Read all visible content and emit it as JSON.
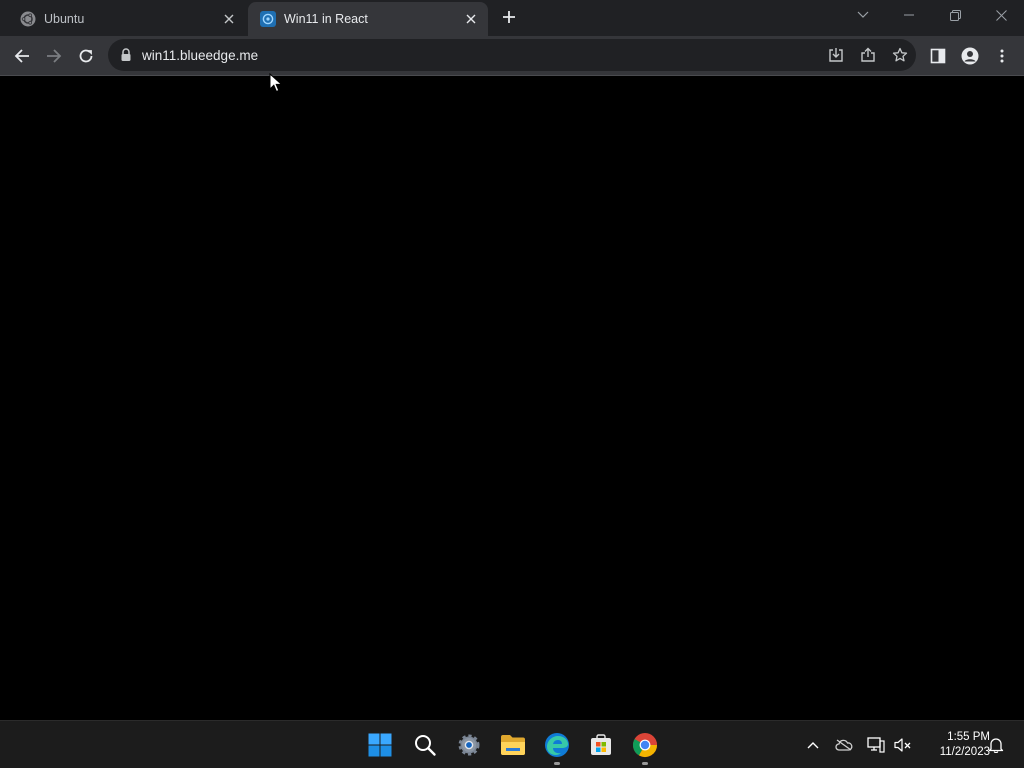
{
  "browser": {
    "tabs": [
      {
        "title": "Ubuntu",
        "active": false,
        "favicon": "ubuntu-logo-icon"
      },
      {
        "title": "Win11 in React",
        "active": true,
        "favicon": "win11-react-favicon-icon"
      }
    ],
    "address": "win11.blueedge.me",
    "colors": {
      "frame": "#202124",
      "toolbar": "#35363a",
      "omnibox": "#202124",
      "text": "#e8eaed"
    }
  },
  "taskbar": {
    "apps": [
      {
        "name": "start-icon"
      },
      {
        "name": "search-icon"
      },
      {
        "name": "settings-icon"
      },
      {
        "name": "file-explorer-icon"
      },
      {
        "name": "edge-icon"
      },
      {
        "name": "store-icon"
      },
      {
        "name": "chrome-icon"
      }
    ],
    "time": "1:55 PM",
    "date": "11/2/2023"
  }
}
